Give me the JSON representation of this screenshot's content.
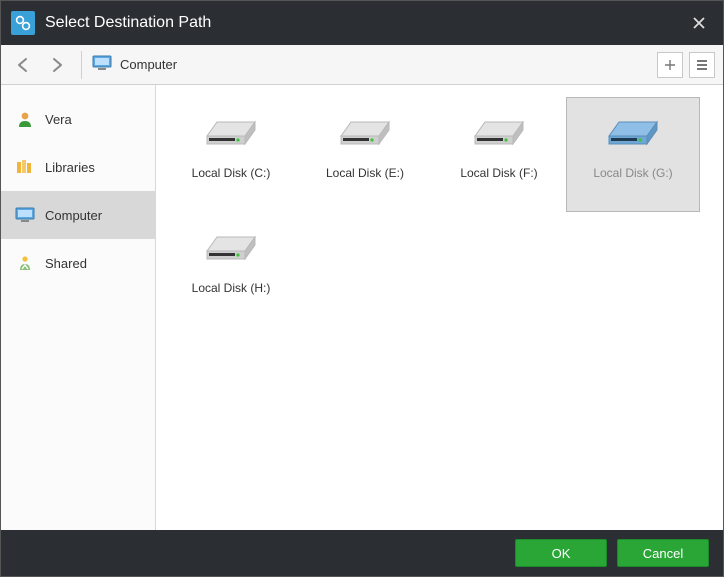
{
  "title": "Select Destination Path",
  "breadcrumb": {
    "label": "Computer"
  },
  "sidebar": {
    "items": [
      {
        "label": "Vera",
        "icon": "user-icon",
        "selected": false
      },
      {
        "label": "Libraries",
        "icon": "libraries-icon",
        "selected": false
      },
      {
        "label": "Computer",
        "icon": "computer-icon",
        "selected": true
      },
      {
        "label": "Shared",
        "icon": "shared-icon",
        "selected": false
      }
    ]
  },
  "drives": [
    {
      "label": "Local Disk (C:)",
      "selected": false,
      "variant": "gray"
    },
    {
      "label": "Local Disk (E:)",
      "selected": false,
      "variant": "gray"
    },
    {
      "label": "Local Disk (F:)",
      "selected": false,
      "variant": "gray"
    },
    {
      "label": "Local Disk (G:)",
      "selected": true,
      "variant": "blue"
    },
    {
      "label": "Local Disk (H:)",
      "selected": false,
      "variant": "gray"
    }
  ],
  "footer": {
    "ok_label": "OK",
    "cancel_label": "Cancel"
  }
}
